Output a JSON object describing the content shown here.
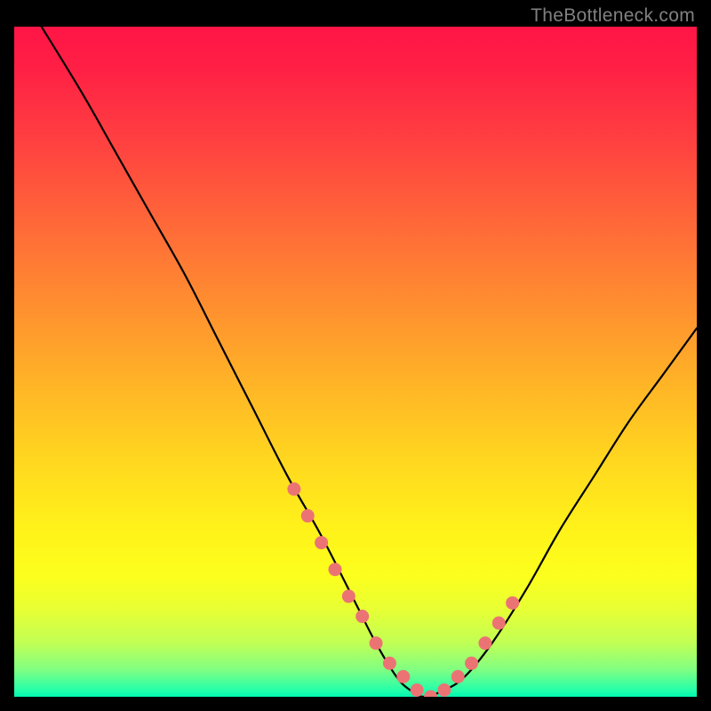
{
  "watermark": "TheBottleneck.com",
  "colors": {
    "background": "#000000",
    "gradient_top": "#ff1546",
    "gradient_mid": "#fff21a",
    "gradient_bottom": "#00f7b0",
    "curve": "#000000",
    "marker": "#ec7373"
  },
  "chart_data": {
    "type": "line",
    "title": "",
    "xlabel": "",
    "ylabel": "",
    "xlim": [
      0,
      100
    ],
    "ylim": [
      0,
      100
    ],
    "grid": false,
    "legend": false,
    "series": [
      {
        "name": "bottleneck-curve",
        "x": [
          4,
          10,
          15,
          20,
          25,
          30,
          35,
          40,
          45,
          50,
          53,
          56,
          58,
          60,
          63,
          66,
          70,
          75,
          80,
          85,
          90,
          95,
          100
        ],
        "values": [
          100,
          90,
          81,
          72,
          63,
          53,
          43,
          33,
          24,
          14,
          8,
          3,
          1,
          0,
          1,
          3,
          8,
          16,
          25,
          33,
          41,
          48,
          55
        ]
      }
    ],
    "markers": {
      "name": "gpu-points",
      "x": [
        41,
        43,
        45,
        47,
        49,
        51,
        53,
        55,
        57,
        59,
        61,
        63,
        65,
        67,
        69,
        71,
        73
      ],
      "values": [
        31,
        27,
        23,
        19,
        15,
        12,
        8,
        5,
        3,
        1,
        0,
        1,
        3,
        5,
        8,
        11,
        14
      ]
    }
  }
}
